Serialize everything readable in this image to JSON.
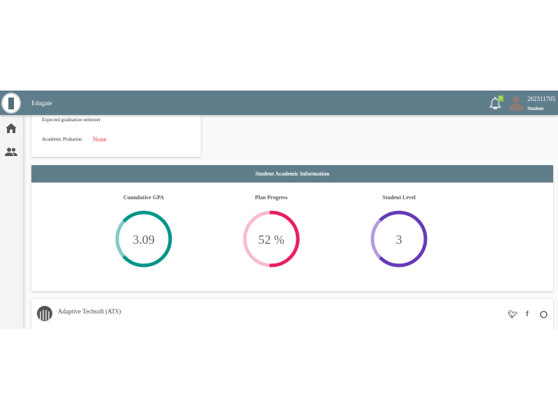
{
  "header": {
    "app_title": "Edugate",
    "notification_count": "0",
    "user_id": "202311705",
    "user_role": "Student"
  },
  "sidebar": {
    "items": [
      {
        "icon": "home-icon"
      },
      {
        "icon": "people-icon"
      }
    ]
  },
  "summary_card": {
    "expected_graduation_label": "Expected graduation semester",
    "probation_label": "Academic Probation",
    "probation_value": "None"
  },
  "academic_info": {
    "title": "Student Academic Information",
    "gauges": [
      {
        "label": "Cumulative GPA",
        "value": "3.09",
        "fraction": 0.77,
        "color": "#009688",
        "track": "#80cbc4"
      },
      {
        "label": "Plan Progress",
        "value": "52 %",
        "fraction": 0.52,
        "color": "#e91e63",
        "track": "#f8bbd0"
      },
      {
        "label": "Student Level",
        "value": "3",
        "fraction": 0.75,
        "color": "#673ab7",
        "track": "#b39ddb"
      }
    ]
  },
  "footer": {
    "company": "Adaptive Techsoft (ATS)",
    "social": [
      "twitter-icon",
      "facebook-icon",
      "github-icon"
    ]
  }
}
